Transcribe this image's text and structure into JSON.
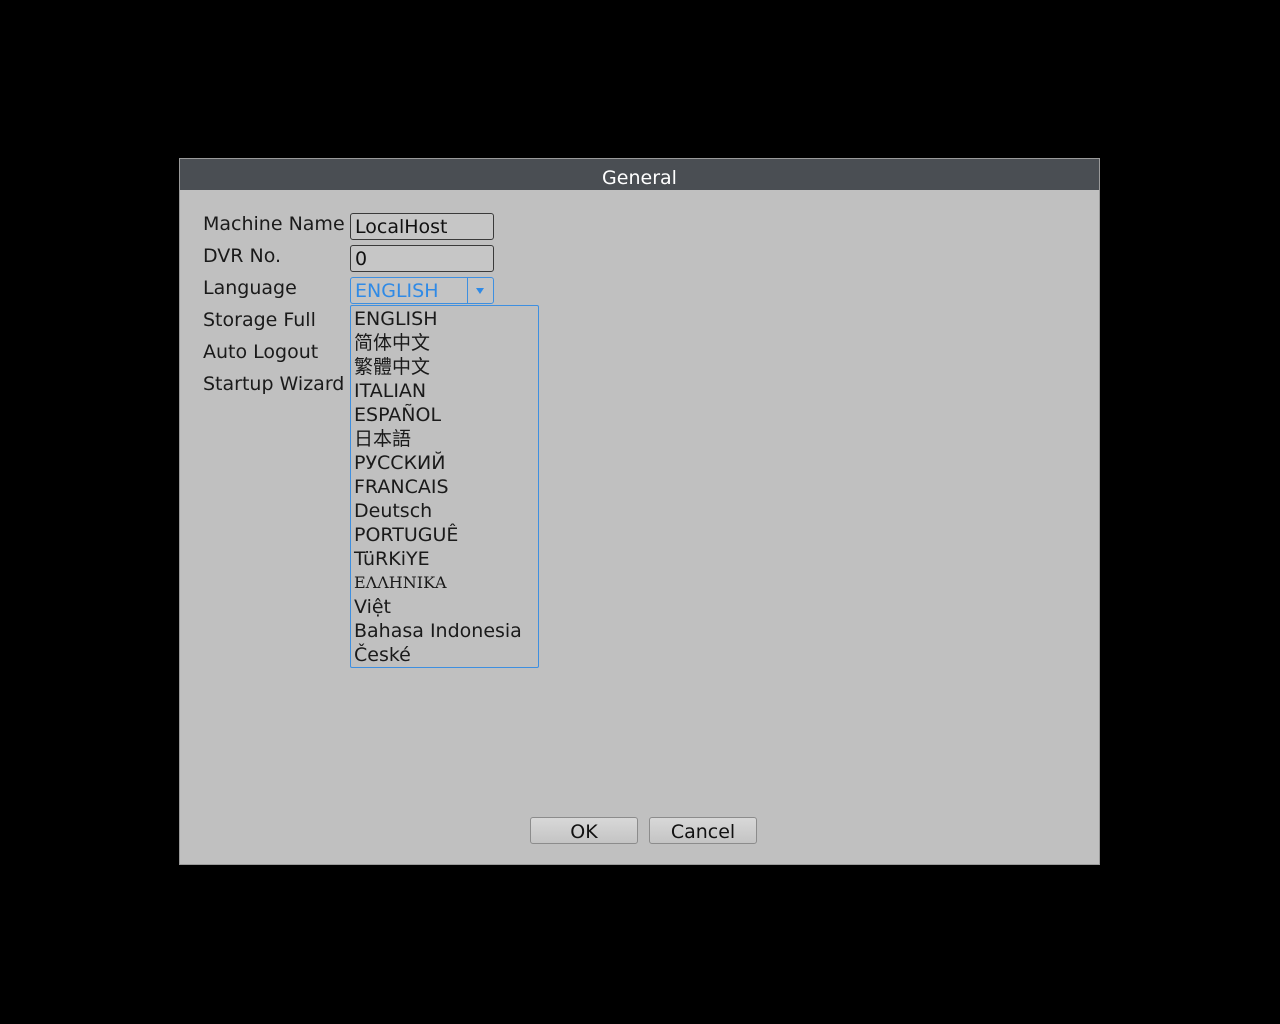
{
  "dialog": {
    "title": "General"
  },
  "form": {
    "machine_name_label": "Machine Name",
    "machine_name_value": "LocalHost",
    "dvr_no_label": "DVR No.",
    "dvr_no_value": "0",
    "language_label": "Language",
    "language_value": "ENGLISH",
    "storage_full_label": "Storage Full",
    "auto_logout_label": "Auto Logout",
    "startup_wizard_label": "Startup Wizard"
  },
  "language_options": [
    "ENGLISH",
    "简体中文",
    "繁體中文",
    "ITALIAN",
    "ESPAÑOL",
    "日本語",
    "РУССКИЙ",
    "FRANCAIS",
    "Deutsch",
    "PORTUGUÊ",
    "TüRKiYE",
    "ΕΛΛΗΝΙΚΑ",
    "Việt",
    "Bahasa Indonesia",
    "České"
  ],
  "buttons": {
    "ok": "OK",
    "cancel": "Cancel"
  },
  "colors": {
    "titlebar": "#4a4e53",
    "panel": "#c0c0c0",
    "accent": "#2f8ae6",
    "background": "#000000"
  }
}
